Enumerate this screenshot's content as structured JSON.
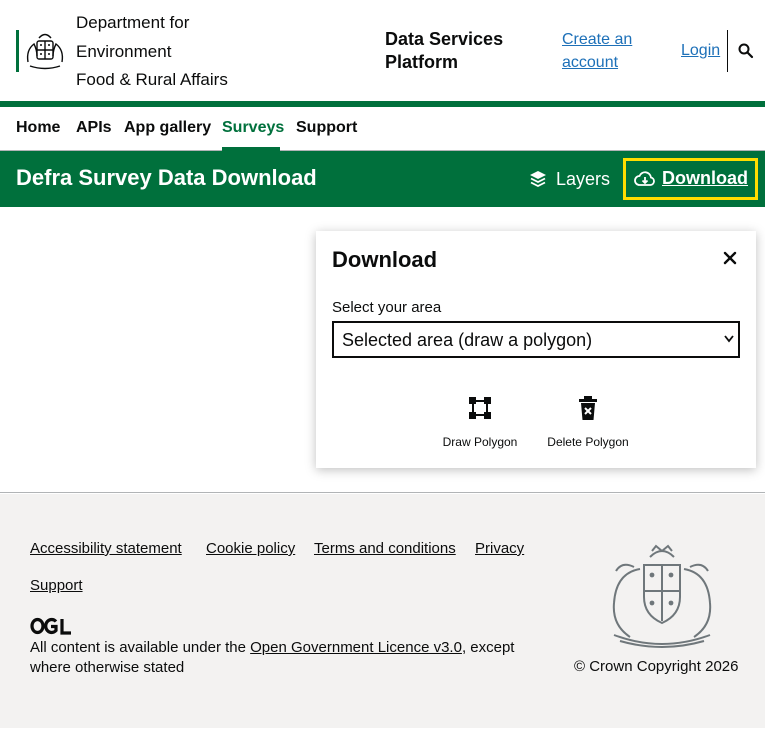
{
  "header": {
    "department_lines": [
      "Department for",
      "Environment",
      "Food & Rural Affairs"
    ],
    "service_name": "Data Services Platform",
    "create_account": "Create an account",
    "login": "Login"
  },
  "nav": {
    "items": [
      {
        "label": "Home",
        "active": false
      },
      {
        "label": "APIs",
        "active": false
      },
      {
        "label": "App gallery",
        "active": false
      },
      {
        "label": "Surveys",
        "active": true
      },
      {
        "label": "Support",
        "active": false
      }
    ]
  },
  "titlebar": {
    "title": "Defra Survey Data Download",
    "layers_label": "Layers",
    "download_label": "Download"
  },
  "panel": {
    "title": "Download",
    "select_label": "Select your area",
    "select_value": "Selected area (draw a polygon)",
    "tools": [
      {
        "label": "Draw Polygon",
        "icon": "draw-polygon-icon"
      },
      {
        "label": "Delete Polygon",
        "icon": "delete-polygon-icon"
      }
    ]
  },
  "footer": {
    "links_row1": [
      "Accessibility statement",
      "Cookie policy",
      "Terms and conditions",
      "Privacy"
    ],
    "links_row2": [
      "Support"
    ],
    "licence_prefix": "All content is available under the ",
    "licence_link": "Open Government Licence v3.0",
    "licence_suffix": ", except where otherwise stated",
    "copyright": "© Crown Copyright 2026"
  },
  "colors": {
    "brand_green": "#00703c",
    "focus_yellow": "#ffdd00",
    "link_blue": "#1d70b8",
    "footer_bg": "#f3f2f1"
  }
}
